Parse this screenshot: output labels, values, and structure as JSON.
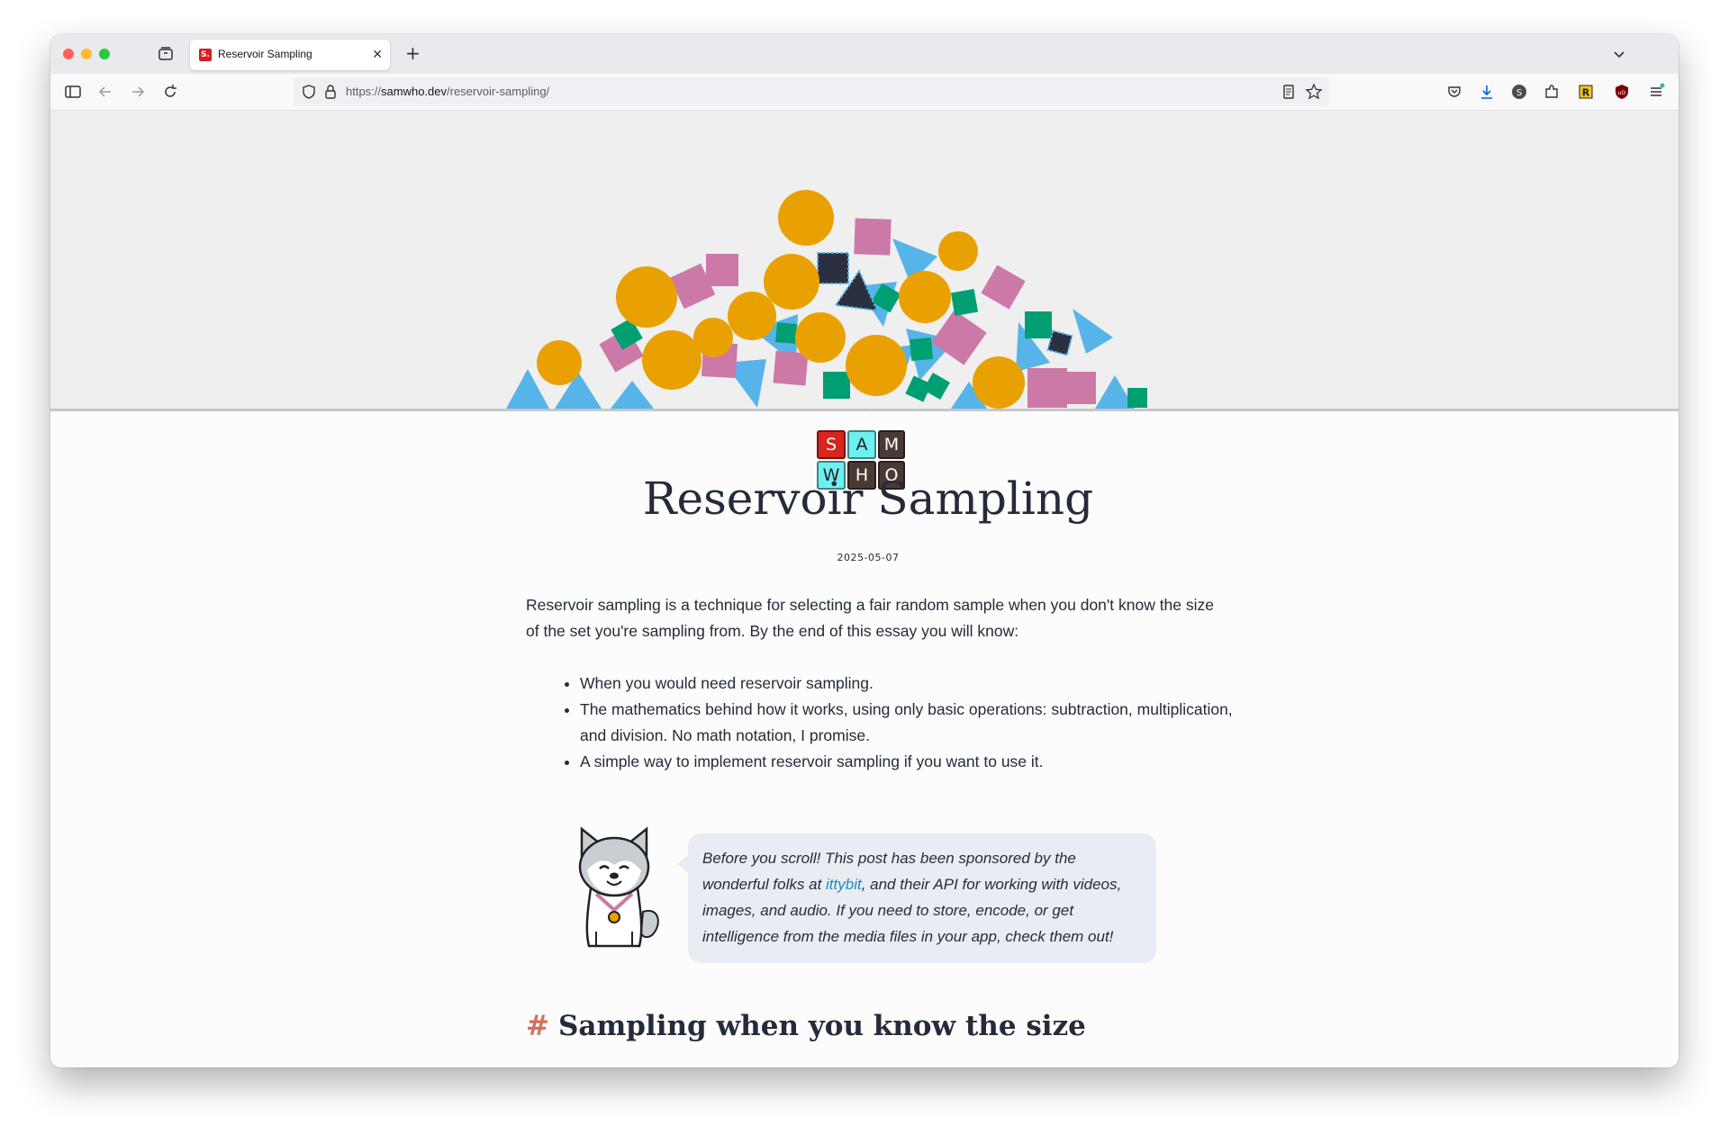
{
  "browser": {
    "tab_title": "Reservoir Sampling",
    "tab_favicon_letter": "S.",
    "url_scheme": "https://",
    "url_host": "samwho.dev",
    "url_path": "/reservoir-sampling/"
  },
  "logo": {
    "tiles": [
      "S",
      "A",
      "M",
      "W",
      "H",
      "O"
    ]
  },
  "article": {
    "title": "Reservoir Sampling",
    "date": "2025-05-07",
    "intro": "Reservoir sampling is a technique for selecting a fair random sample when you don't know the size of the set you're sampling from. By the end of this essay you will know:",
    "bullets": [
      "When you would need reservoir sampling.",
      "The mathematics behind how it works, using only basic operations: subtraction, multiplication, and division. No math notation, I promise.",
      "A simple way to implement reservoir sampling if you want to use it."
    ],
    "sponsor": {
      "before": "Before you scroll! This post has been sponsored by the wonderful folks at ",
      "link_text": "ittybit",
      "after": ", and their API for working with videos, images, and audio. If you need to store, encode, or get intelligence from the media files in your app, check them out!"
    },
    "section_hash": "#",
    "section_heading": "Sampling when you know the size"
  },
  "colors": {
    "orange": "#e8a100",
    "pink": "#cc79a7",
    "green": "#009e73",
    "blue": "#56b4e9",
    "dark": "#2b3041"
  }
}
